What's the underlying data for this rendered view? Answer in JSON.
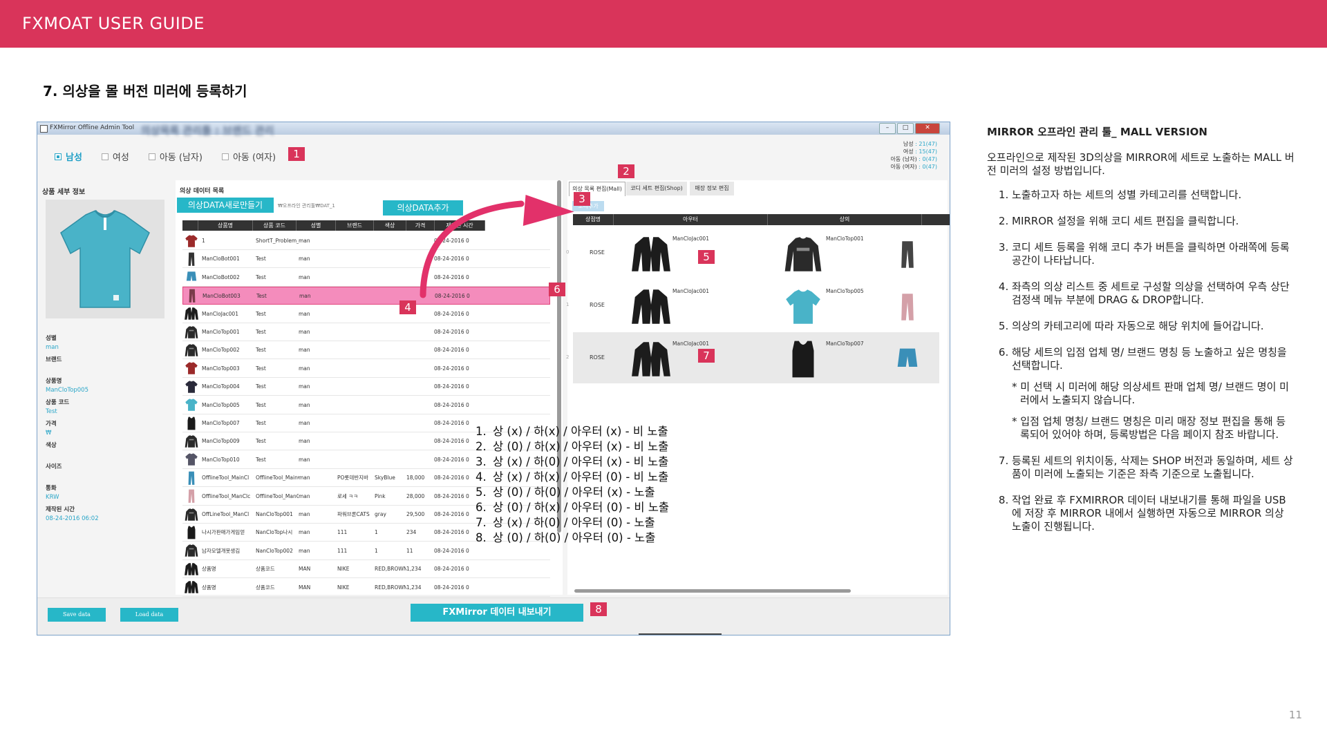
{
  "header": {
    "title": "FXMOAT USER GUIDE"
  },
  "section": {
    "title": "7. 의상을 몰 버전 미러에 등록하기"
  },
  "page_number": "11",
  "window": {
    "title": "FXMirror Offline Admin Tool",
    "blurred_title": "의상목록 관리툴 : 브랜드 관리",
    "filters": [
      {
        "label": "남성",
        "checked": true
      },
      {
        "label": "여성",
        "checked": false
      },
      {
        "label": "아동 (남자)",
        "checked": false
      },
      {
        "label": "아동 (여자)",
        "checked": false
      }
    ],
    "counts": [
      {
        "label": "남성",
        "value": ": 21(47)"
      },
      {
        "label": "여성",
        "value": ": 15(47)"
      },
      {
        "label": "아동 (남자)",
        "value": ": 0(47)"
      },
      {
        "label": "아동 (여자)",
        "value": ": 0(47)"
      }
    ],
    "detail": {
      "title": "상품 세부 정보",
      "fields": [
        {
          "label": "성별",
          "value": "man"
        },
        {
          "label": "브랜드",
          "value": ""
        },
        {
          "label": "상품명",
          "value": "ManCloTop005"
        },
        {
          "label": "상품 코드",
          "value": "Test"
        },
        {
          "label": "가격",
          "value": "₩"
        },
        {
          "label": "색상",
          "value": ""
        },
        {
          "label": "사이즈",
          "value": ""
        },
        {
          "label": "통화",
          "value": "KRW"
        },
        {
          "label": "제작된 시간",
          "value": "08-24-2016 06:02"
        }
      ]
    },
    "list": {
      "title": "의상 데이터 목록",
      "new_button": "의상DATA새로만들기",
      "add_button": "의상DATA추가",
      "path": "₩오프라인 관리툴₩DAT_1",
      "columns": [
        "상품명",
        "상품 코드",
        "성별",
        "브랜드",
        "색상",
        "가격",
        "제작된 시간"
      ],
      "rows": [
        {
          "name": "1",
          "code": "ShortT_Problem_te",
          "gender": "man",
          "brand": "",
          "color": "",
          "price": "",
          "date": "08-24-2016 0",
          "kind": "tshirt",
          "color_hex": "#9b2a2a"
        },
        {
          "name": "ManCloBot001",
          "code": "Test",
          "gender": "man",
          "brand": "",
          "color": "",
          "price": "",
          "date": "08-24-2016 0",
          "kind": "pants",
          "color_hex": "#333333"
        },
        {
          "name": "ManCloBot002",
          "code": "Test",
          "gender": "man",
          "brand": "",
          "color": "",
          "price": "",
          "date": "08-24-2016 0",
          "kind": "shorts",
          "color_hex": "#3a8fb8"
        },
        {
          "name": "ManCloBot003",
          "code": "Test",
          "gender": "man",
          "brand": "",
          "color": "",
          "price": "",
          "date": "08-24-2016 0",
          "kind": "pants",
          "color_hex": "#7a3b4a",
          "selected": true
        },
        {
          "name": "ManCloJac001",
          "code": "Test",
          "gender": "man",
          "brand": "",
          "color": "",
          "price": "",
          "date": "08-24-2016 0",
          "kind": "jacket",
          "color_hex": "#1c1c1c"
        },
        {
          "name": "ManCloTop001",
          "code": "Test",
          "gender": "man",
          "brand": "",
          "color": "",
          "price": "",
          "date": "08-24-2016 0",
          "kind": "longsleeve",
          "color_hex": "#2a2a2a"
        },
        {
          "name": "ManCloTop002",
          "code": "Test",
          "gender": "man",
          "brand": "",
          "color": "",
          "price": "",
          "date": "08-24-2016 0",
          "kind": "longsleeve",
          "color_hex": "#2a2a2a"
        },
        {
          "name": "ManCloTop003",
          "code": "Test",
          "gender": "man",
          "brand": "",
          "color": "",
          "price": "",
          "date": "08-24-2016 0",
          "kind": "tshirt",
          "color_hex": "#9b2a2a"
        },
        {
          "name": "ManCloTop004",
          "code": "Test",
          "gender": "man",
          "brand": "",
          "color": "",
          "price": "",
          "date": "08-24-2016 0",
          "kind": "tshirt",
          "color_hex": "#2a2a3a"
        },
        {
          "name": "ManCloTop005",
          "code": "Test",
          "gender": "man",
          "brand": "",
          "color": "",
          "price": "",
          "date": "08-24-2016 0",
          "kind": "tshirt",
          "color_hex": "#49b3c8"
        },
        {
          "name": "ManCloTop007",
          "code": "Test",
          "gender": "man",
          "brand": "",
          "color": "",
          "price": "",
          "date": "08-24-2016 0",
          "kind": "tank",
          "color_hex": "#1a1a1a"
        },
        {
          "name": "ManCloTop009",
          "code": "Test",
          "gender": "man",
          "brand": "",
          "color": "",
          "price": "",
          "date": "08-24-2016 0",
          "kind": "longsleeve",
          "color_hex": "#2a2a2a"
        },
        {
          "name": "ManCloTop010",
          "code": "Test",
          "gender": "man",
          "brand": "",
          "color": "",
          "price": "",
          "date": "08-24-2016 0",
          "kind": "tshirt",
          "color_hex": "#555566"
        },
        {
          "name": "OfflineTool_MainCl",
          "code": "OfflineTool_MainCl",
          "gender": "man",
          "brand": "PO롯데반지바",
          "color": "SkyBlue",
          "price": "18,000",
          "date": "08-24-2016 0",
          "kind": "pants",
          "color_hex": "#3a8fb8"
        },
        {
          "name": "OfflineTool_ManClc",
          "code": "OfflineTool_ManClc",
          "gender": "man",
          "brand": "로세 ㅋㅋ",
          "color": "Pink",
          "price": "28,000",
          "date": "08-24-2016 0",
          "kind": "pants",
          "color_hex": "#d4a0a8"
        },
        {
          "name": "OffLineTool_ManCl",
          "code": "NanCloTop001",
          "gender": "man",
          "brand": "파워브론CATS",
          "color": "gray",
          "price": "29,500",
          "date": "08-24-2016 0",
          "kind": "longsleeve",
          "color_hex": "#2a2a2a"
        },
        {
          "name": "나시가판매가게임얻",
          "code": "NanCloTop나시",
          "gender": "man",
          "brand": "111",
          "color": "1",
          "price": "234",
          "date": "08-24-2016 0",
          "kind": "tank",
          "color_hex": "#1a1a1a"
        },
        {
          "name": "남자모델개못생김",
          "code": "NanCloTop002",
          "gender": "man",
          "brand": "111",
          "color": "1",
          "price": "11",
          "date": "08-24-2016 0",
          "kind": "longsleeve",
          "color_hex": "#2a2a2a"
        },
        {
          "name": "상품명",
          "code": "상품코드",
          "gender": "MAN",
          "brand": "NIKE",
          "color": "RED,BROWN",
          "price": "1,234",
          "date": "08-24-2016 0",
          "kind": "jacket",
          "color_hex": "#1c1c1c"
        },
        {
          "name": "상품명",
          "code": "상품코드",
          "gender": "MAN",
          "brand": "NIKE",
          "color": "RED,BROWN",
          "price": "1,234",
          "date": "08-24-2016 0",
          "kind": "jacket",
          "color_hex": "#1c1c1c"
        },
        {
          "name": "상품명",
          "code": "상품코드",
          "gender": "MAN",
          "brand": "NIKE",
          "color": "RED,BROWN",
          "price": "1,234",
          "date": "08-24-2016 0",
          "kind": "jacket",
          "color_hex": "#1c1c1c"
        }
      ]
    },
    "preview": {
      "tabs": [
        "의상 목록 편집(Mall)",
        "코디 세트 편집(Shop)",
        "매장 정보 편집"
      ],
      "add_label": "코디추가",
      "columns": [
        "상점명",
        "아우터",
        "상의",
        ""
      ],
      "sets": [
        {
          "index": "0",
          "brand": "ROSE",
          "outer": "ManCloJac001",
          "top": "ManCloTop001",
          "top_kind": "longsleeve",
          "top_color": "#2a2a2a",
          "bottom_color": "#444444"
        },
        {
          "index": "1",
          "brand": "ROSE",
          "outer": "ManCloJac001",
          "top": "ManCloTop005",
          "top_kind": "tshirt",
          "top_color": "#49b3c8",
          "bottom_color": "#d4a0a8"
        },
        {
          "index": "2",
          "brand": "ROSE",
          "outer": "ManCloJac001",
          "top": "ManCloTop007",
          "top_kind": "tank",
          "top_color": "#1a1a1a",
          "bottom_color": "#3a8fb8",
          "bottom_kind": "shorts"
        }
      ]
    },
    "buttons": {
      "save": "Save data",
      "load": "Load data",
      "export": "FXMirror 데이터 내보내기"
    },
    "markers": [
      "1",
      "2",
      "3",
      "4",
      "5",
      "6",
      "7",
      "8"
    ],
    "rules": [
      "상 (x) / 하(x) / 아우터 (x) - 비 노출",
      "상 (0) / 하(x) / 아우터 (x) - 비 노출",
      "상 (x) / 하(0) / 아우터 (x) - 비 노출",
      "상 (x) / 하(x) / 아우터 (0) - 비 노출",
      "상 (0) / 하(0) / 아우터 (x) - 노출",
      "상 (0) / 하(x) / 아우터 (0) - 비 노출",
      "상 (x) / 하(0) / 아우터 (0) - 노출",
      "상 (0) / 하(0) / 아우터 (0) - 노출"
    ]
  },
  "guide": {
    "heading": "MIRROR 오프라인 관리 툴_ MALL VERSION",
    "intro": "오프라인으로 제작된 3D의상을 MIRROR에 세트로 노출하는 MALL 버전 미러의 설정 방법입니다.",
    "steps": [
      {
        "text": "노출하고자 하는 세트의 성별 카테고리를 선택합니다."
      },
      {
        "text": "MIRROR 설정을 위해 코디 세트 편집을 클릭합니다."
      },
      {
        "text": "코디 세트 등록을 위해 코디 추가 버튼을 클릭하면 아래쪽에 등록 공간이 나타납니다."
      },
      {
        "text": "좌측의 의상 리스트 중 세트로 구성할 의상을 선택하여 우측 상단 검정색 메뉴 부분에 DRAG & DROP합니다."
      },
      {
        "text": "의상의 카테고리에 따라 자동으로 해당 위치에 들어갑니다."
      },
      {
        "text": "해당 세트의 입점 업체 명/ 브랜드 명칭 등 노출하고 싶은 명칭을 선택합니다.",
        "notes": [
          "* 미 선택 시 미러에 해당 의상세트 판매 업체 명/ 브랜드 명이 미러에서 노출되지 않습니다.",
          "* 입점 업체 명칭/ 브랜드 명칭은 미리 매장 정보 편집을 통해 등록되어 있어야 하며, 등록방법은 다음 페이지 참조 바랍니다."
        ]
      },
      {
        "text": "등록된 세트의 위치이동, 삭제는 SHOP 버전과 동일하며, 세트 상품이 미러에 노출되는 기준은 좌측 기준으로 노출됩니다."
      },
      {
        "text": "작업 완료 후 FXMIRROR 데이터 내보내기를 통해 파일을 USB에 저장 후 MIRROR 내에서 실행하면 자동으로 MIRROR 의상 노출이 진행됩니다."
      }
    ]
  },
  "colors": {
    "accent": "#d9345a",
    "teal": "#27b7c8",
    "selected_row": "#f48cbc"
  }
}
